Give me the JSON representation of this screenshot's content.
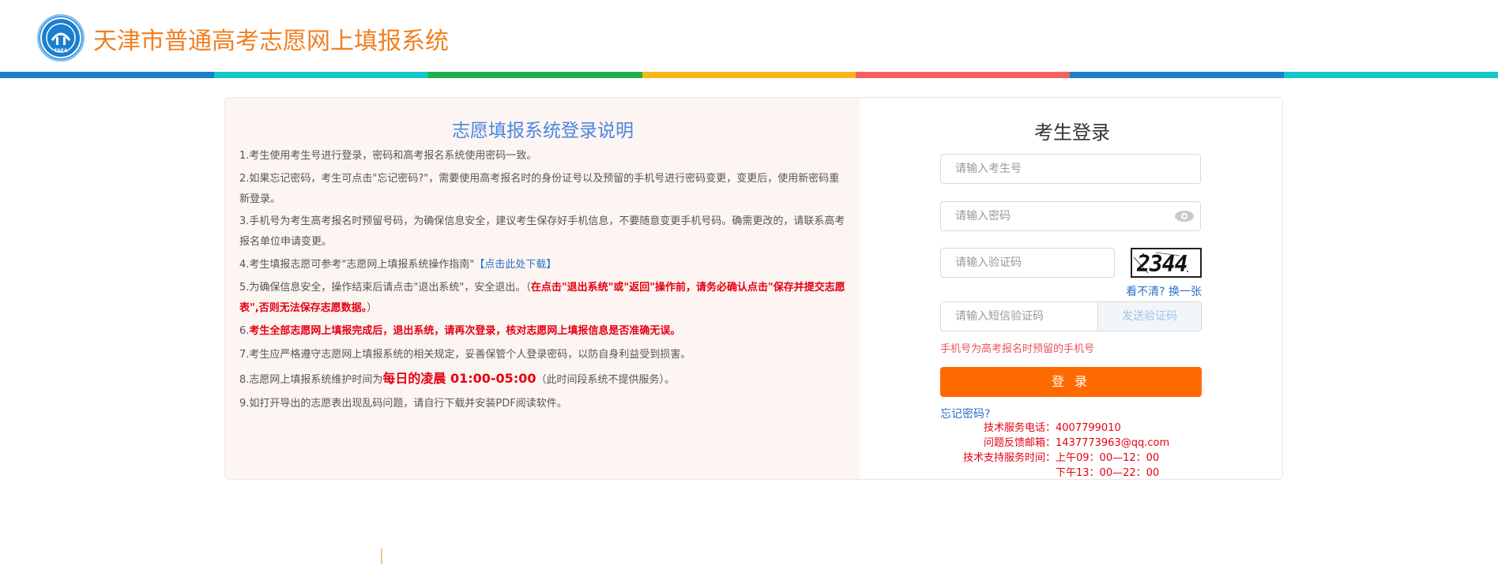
{
  "header": {
    "logo_text": "TAEA",
    "site_title": "天津市普通高考志愿网上填报系统",
    "stripe_colors": [
      "#1a7fd0",
      "#12c8c4",
      "#22b04a",
      "#f9b51c",
      "#f5615f",
      "#1a7fd0",
      "#12c8c4"
    ]
  },
  "instructions": {
    "title": "志愿填报系统登录说明",
    "item1": "1.考生使用考生号进行登录，密码和高考报名系统使用密码一致。",
    "item2": "2.如果忘记密码，考生可点击\"忘记密码?\"，需要使用高考报名时的身份证号以及预留的手机号进行密码变更，变更后，使用新密码重新登录。",
    "item3": "3.手机号为考生高考报名时预留号码，为确保信息安全，建议考生保存好手机信息，不要随意变更手机号码。确需更改的，请联系高考报名单位申请变更。",
    "item4_prefix": "4.考生填报志愿可参考\"志愿网上填报系统操作指南\"",
    "item4_link": "【点击此处下载】",
    "item5_prefix": "5.为确保信息安全，操作结束后请点击\"退出系统\"，安全退出。（",
    "item5_red": "在点击\"退出系统\"或\"返回\"操作前，请务必确认点击\"保存并提交志愿表\",否则无法保存志愿数据。",
    "item5_suffix": "）",
    "item6_prefix": "6.",
    "item6_red": "考生全部志愿网上填报完成后，退出系统，请再次登录，核对志愿网上填报信息是否准确无误。",
    "item7": "7.考生应严格遵守志愿网上填报系统的相关规定，妥善保管个人登录密码，以防自身利益受到损害。",
    "item8_prefix": "8.志愿网上填报系统维护时间为",
    "item8_red": "每日的凌晨 01:00-05:00",
    "item8_suffix": "（此时间段系统不提供服务）。",
    "item9": "9.如打开导出的志愿表出现乱码问题，请自行下载并安装PDF阅读软件。"
  },
  "login": {
    "title": "考生登录",
    "exam_no_placeholder": "请输入考生号",
    "password_placeholder": "请输入密码",
    "captcha_placeholder": "请输入验证码",
    "captcha_image_text": "2344",
    "refresh_captcha": "看不清? 换一张",
    "sms_placeholder": "请输入短信验证码",
    "send_code": "发送验证码",
    "phone_hint": "手机号为高考报名时预留的手机号",
    "login_button": "登 录",
    "forgot_password": "忘记密码?"
  },
  "support": {
    "phone_label": "技术服务电话：",
    "phone_value": "4007799010",
    "email_label": "问题反馈邮箱：",
    "email_value": "1437773963@qq.com",
    "hours_label": "技术支持服务时间：",
    "hours_am": "上午09：00—12：00",
    "hours_pm": "下午13：00—22：00"
  }
}
